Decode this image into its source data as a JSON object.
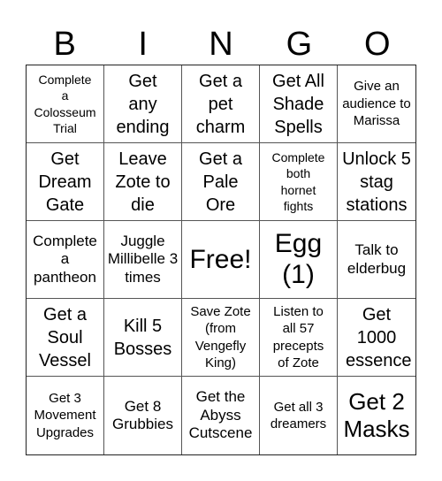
{
  "header": {
    "letters": [
      "B",
      "I",
      "N",
      "G",
      "O"
    ]
  },
  "board": {
    "cells": [
      [
        "Complete a Colosseum Trial",
        "Get any ending",
        "Get a pet charm",
        "Get All Shade Spells",
        "Give an audience to Marissa"
      ],
      [
        "Get Dream Gate",
        "Leave Zote to die",
        "Get a Pale Ore",
        "Complete both hornet fights",
        "Unlock 5 stag stations"
      ],
      [
        "Complete a pantheon",
        "Juggle Millibelle 3 times",
        "Free!",
        "Egg (1)",
        "Talk to elderbug"
      ],
      [
        "Get a Soul Vessel",
        "Kill 5 Bosses",
        "Save Zote (from Vengefly King)",
        "Listen to all 57 precepts of Zote",
        "Get 1000 essence"
      ],
      [
        "Get 3 Movement Upgrades",
        "Get 8 Grubbies",
        "Get the Abyss Cutscene",
        "Get all 3 dreamers",
        "Get 2 Masks"
      ]
    ],
    "free_cell": "Free!"
  }
}
